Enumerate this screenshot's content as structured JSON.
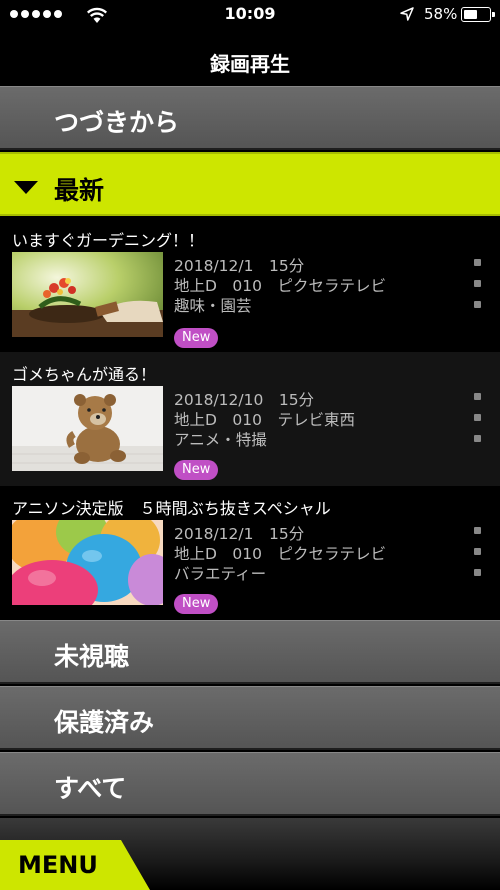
{
  "status_bar": {
    "time": "10:09",
    "battery_percent": "58%",
    "battery_level": 0.58,
    "signal_bars": 5
  },
  "nav": {
    "title": "録画再生"
  },
  "sections": {
    "continue": "つづきから",
    "latest": "最新",
    "unwatched": "未視聴",
    "protected": "保護済み",
    "all": "すべて"
  },
  "programs": [
    {
      "title": "いますぐガーデニング！！",
      "date": "2018/12/1　15分",
      "channel": "地上D　010　ピクセラテレビ",
      "genre": "趣味・園芸",
      "badge": "New",
      "thumbnail_icon": "gardening-photo"
    },
    {
      "title": "ゴメちゃんが通る！",
      "date": "2018/12/10　15分",
      "channel": "地上D　010　テレビ東西",
      "genre": "アニメ・特撮",
      "badge": "New",
      "thumbnail_icon": "teddy-bear-photo"
    },
    {
      "title": "アニソン決定版　５時間ぶち抜きスペシャル",
      "date": "2018/12/1　15分",
      "channel": "地上D　010　ピクセラテレビ",
      "genre": "バラエティー",
      "badge": "New",
      "thumbnail_icon": "balloons-photo"
    }
  ],
  "menu": {
    "label": "MENU"
  },
  "colors": {
    "accent": "#cde600",
    "badge": "#c04fc5",
    "row_gray": "#606060",
    "program_bg_dark": "#000000",
    "program_bg_alt": "#141414"
  }
}
